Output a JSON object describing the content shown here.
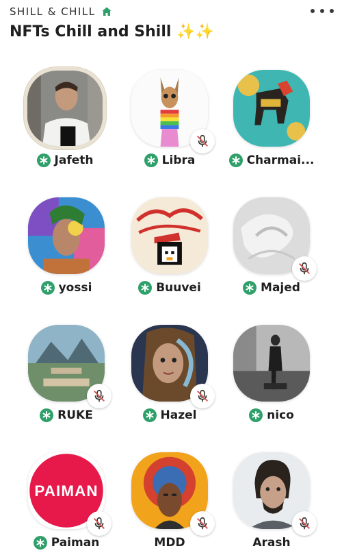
{
  "header": {
    "club_name": "SHILL & CHILL",
    "room_title": "NFTs Chill and Shill",
    "room_title_emoji": "✨✨"
  },
  "colors": {
    "accent_green": "#2fa06a",
    "mute_red": "#d9534f",
    "paiman_red": "#e7194b"
  },
  "speakers": [
    {
      "name": "Jafeth",
      "moderator": true,
      "muted": false,
      "speaking": true
    },
    {
      "name": "Libra",
      "moderator": true,
      "muted": true,
      "speaking": false
    },
    {
      "name": "Charmai...",
      "moderator": true,
      "muted": false,
      "speaking": false
    },
    {
      "name": "yossi",
      "moderator": true,
      "muted": false,
      "speaking": false
    },
    {
      "name": "Buuvei",
      "moderator": true,
      "muted": false,
      "speaking": false
    },
    {
      "name": "Majed",
      "moderator": true,
      "muted": true,
      "speaking": false
    },
    {
      "name": "RUKE",
      "moderator": true,
      "muted": true,
      "speaking": false
    },
    {
      "name": "Hazel",
      "moderator": true,
      "muted": true,
      "speaking": false
    },
    {
      "name": "nico",
      "moderator": true,
      "muted": false,
      "speaking": false
    },
    {
      "name": "Paiman",
      "moderator": true,
      "muted": true,
      "speaking": false,
      "logo_text": "PAIMAN"
    },
    {
      "name": "MDD",
      "moderator": false,
      "muted": true,
      "speaking": false
    },
    {
      "name": "Arash",
      "moderator": false,
      "muted": true,
      "speaking": false
    }
  ]
}
